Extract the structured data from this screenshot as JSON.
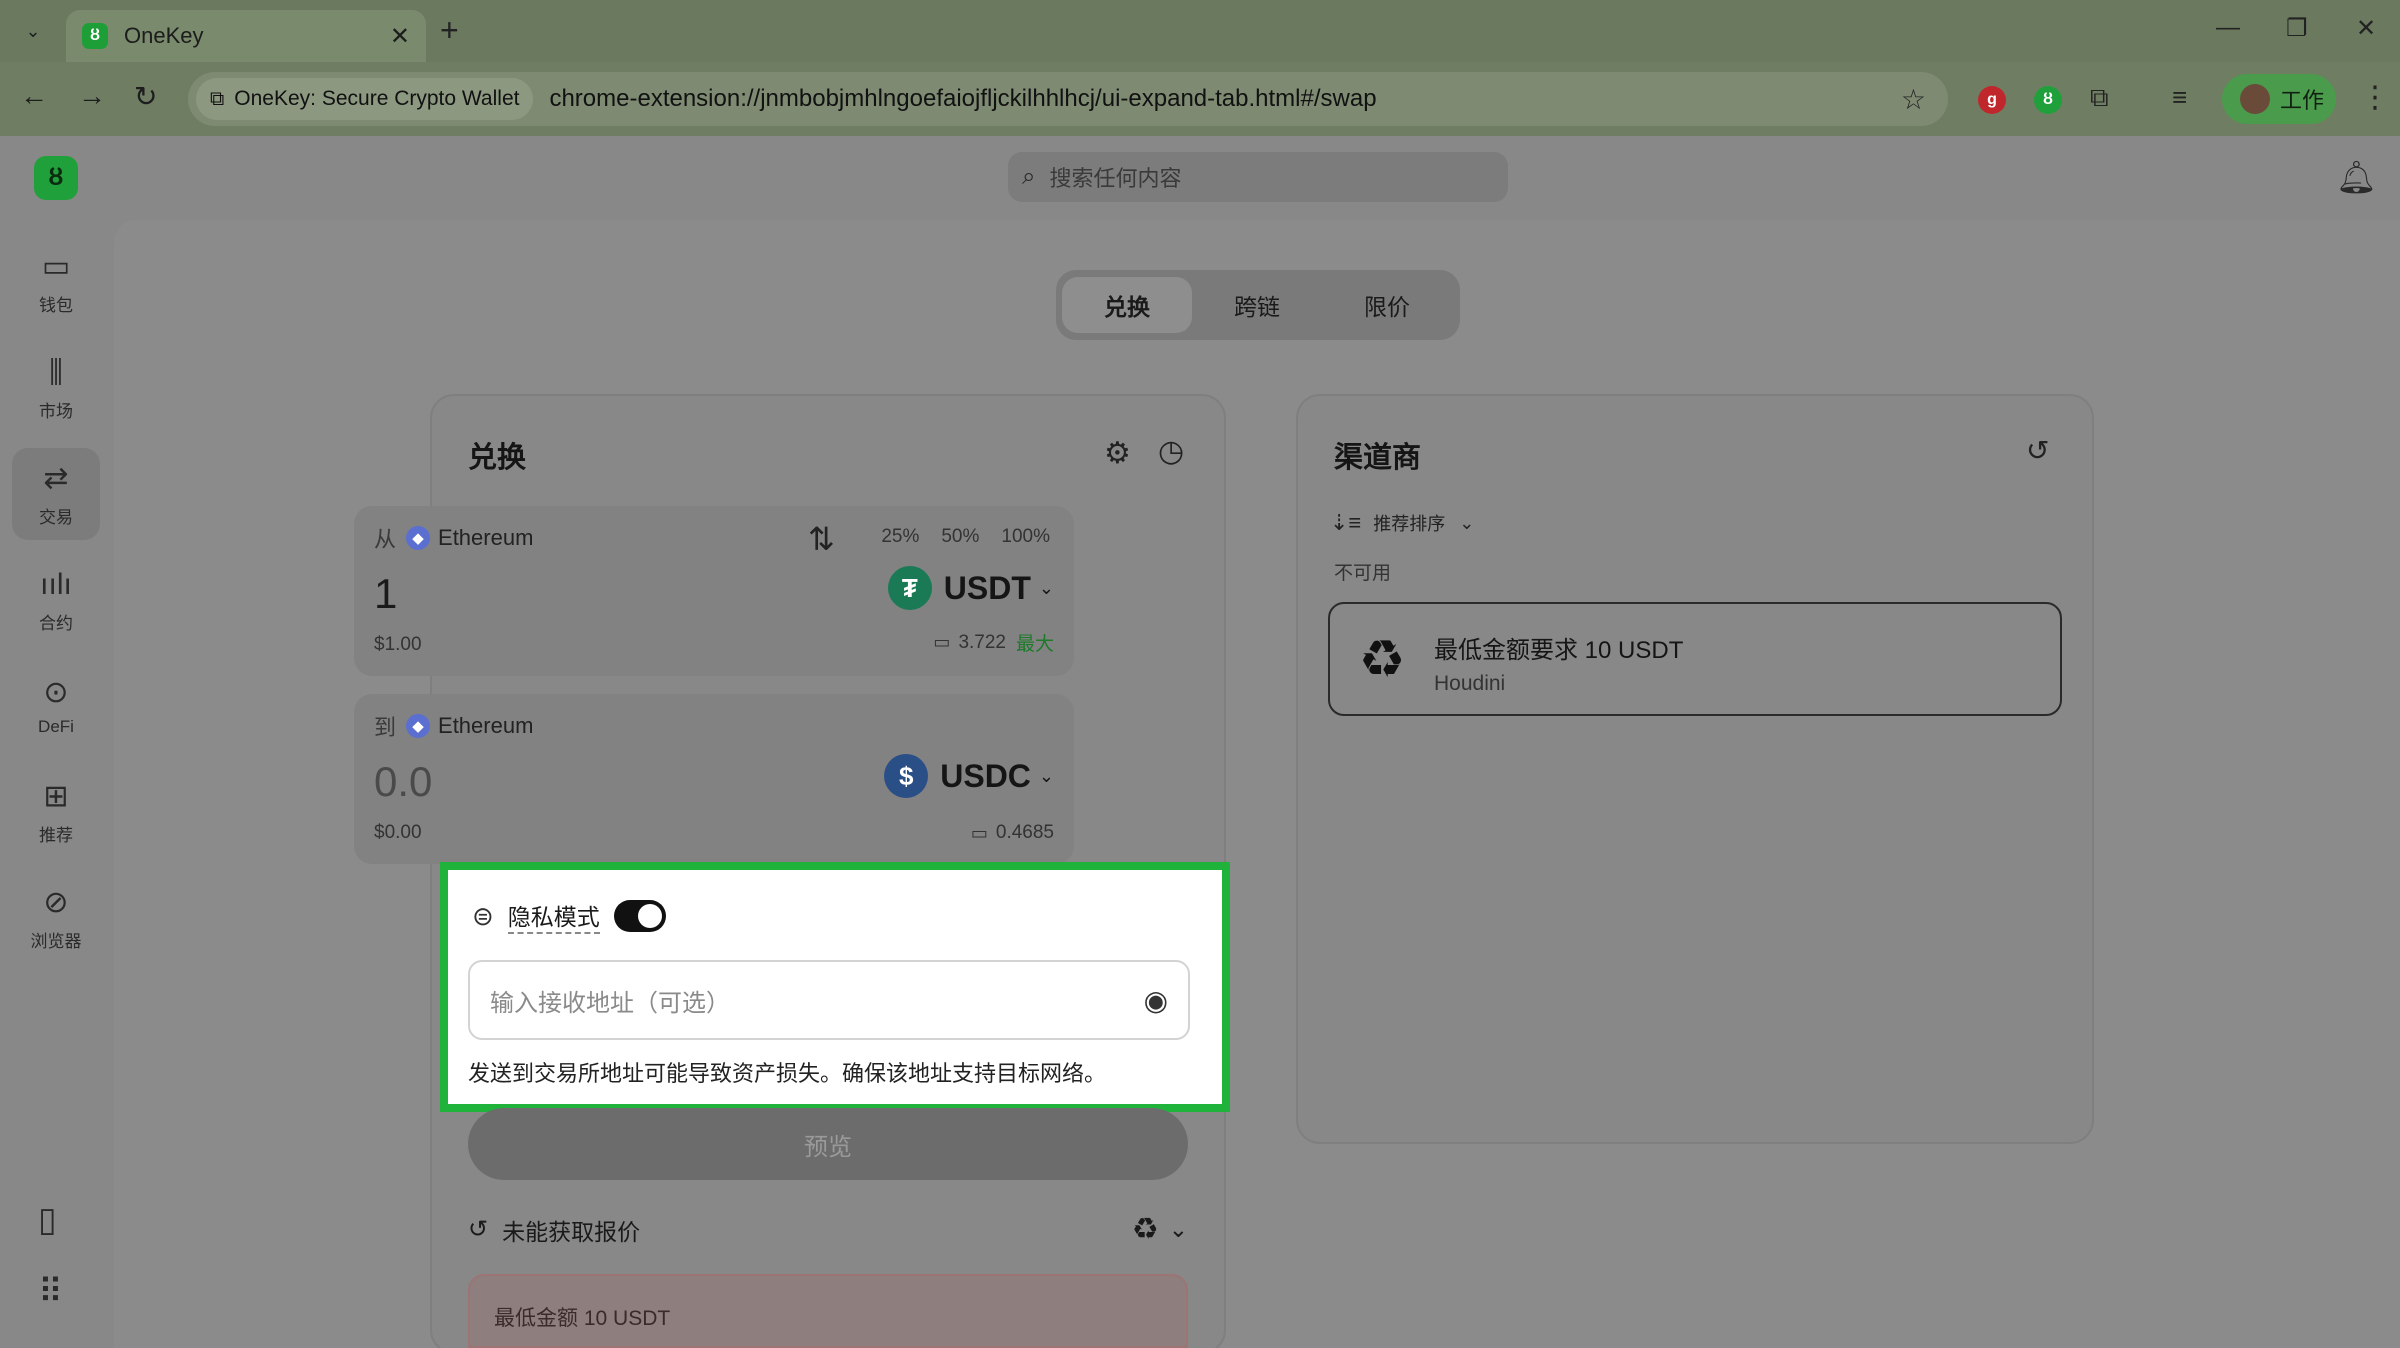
{
  "browser": {
    "tab_title": "OneKey",
    "tab_favicon": "onekey-logo",
    "site_chip": "OneKey: Secure Crypto Wallet",
    "url": "chrome-extension://jnmbobjmhlngoefaiojfljckilhhlhcj/ui-expand-tab.html#/swap",
    "profile_label": "工作"
  },
  "sidebar": {
    "items": [
      {
        "label": "钱包",
        "icon": "wallet-icon"
      },
      {
        "label": "市场",
        "icon": "market-icon"
      },
      {
        "label": "交易",
        "icon": "swap-icon"
      },
      {
        "label": "合约",
        "icon": "perps-icon"
      },
      {
        "label": "DeFi",
        "icon": "defi-icon"
      },
      {
        "label": "推荐",
        "icon": "gift-icon"
      },
      {
        "label": "浏览器",
        "icon": "compass-icon"
      }
    ]
  },
  "header": {
    "search_placeholder": "搜索任何内容"
  },
  "mode_tabs": [
    "兑换",
    "跨链",
    "限价"
  ],
  "swap": {
    "title": "兑换",
    "from": {
      "dir": "从",
      "chain": "Ethereum",
      "pcts": [
        "25%",
        "50%",
        "100%"
      ],
      "amount": "1",
      "token": "USDT",
      "usd": "$1.00",
      "balance": "3.722",
      "max_label": "最大"
    },
    "to": {
      "dir": "到",
      "chain": "Ethereum",
      "amount": "0.0",
      "token": "USDC",
      "usd": "$0.00",
      "balance": "0.4685"
    },
    "privacy_label": "隐私模式",
    "privacy_on": true,
    "address_placeholder": "输入接收地址（可选）",
    "warning": "发送到交易所地址可能导致资产损失。确保该地址支持目标网络。",
    "preview_label": "预览",
    "quote_status": "未能获取报价",
    "min_notice": "最低金额 10 USDT"
  },
  "providers": {
    "title": "渠道商",
    "sort_label": "推荐排序",
    "unavailable_label": "不可用",
    "items": [
      {
        "title": "最低金额要求 10 USDT",
        "name": "Houdini"
      }
    ]
  },
  "colors": {
    "highlight": "#1fb33c",
    "brand_green": "#1fa03a",
    "usdt": "#1a7a55",
    "usdc": "#2a4f86"
  }
}
